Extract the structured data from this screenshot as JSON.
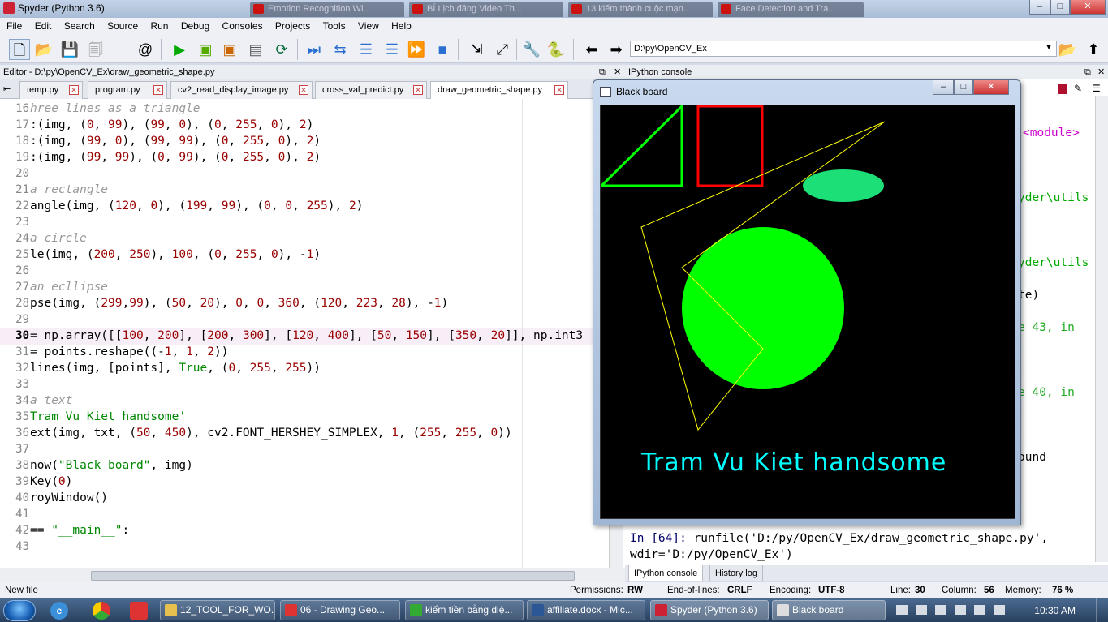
{
  "window": {
    "title": "Spyder (Python 3.6)"
  },
  "background_tabs": [
    "Emotion Recognition Wi...",
    "BÍ Lịch đăng Video Th...",
    "13 kiếm thành cuộc mạn...",
    "Face Detection and Tra..."
  ],
  "menu": [
    "File",
    "Edit",
    "Search",
    "Source",
    "Run",
    "Debug",
    "Consoles",
    "Projects",
    "Tools",
    "View",
    "Help"
  ],
  "toolbar": {
    "path": "D:\\py\\OpenCV_Ex",
    "icons": [
      "new-file-icon",
      "open-folder-icon",
      "save-icon",
      "save-all-icon",
      "at-icon",
      "run-icon",
      "run-cell-icon",
      "run-cell-advance-icon",
      "run-selection-icon",
      "rerun-icon",
      "debug-icon",
      "step-icon",
      "step-into-icon",
      "step-return-icon",
      "continue-icon",
      "stop-icon",
      "maximize-pane-icon",
      "fullscreen-icon",
      "preferences-icon",
      "python-path-icon",
      "back-icon",
      "forward-icon"
    ]
  },
  "editor": {
    "header": "Editor - D:\\py\\OpenCV_Ex\\draw_geometric_shape.py",
    "tabs": [
      "temp.py",
      "program.py",
      "cv2_read_display_image.py",
      "cross_val_predict.py",
      "draw_geometric_shape.py"
    ],
    "lines": [
      {
        "n": "16",
        "t": "hree lines as a triangle"
      },
      {
        "n": "17",
        "t": ":(img, (0, 99), (99, 0), (0, 255, 0), 2)"
      },
      {
        "n": "18",
        "t": ":(img, (99, 0), (99, 99), (0, 255, 0), 2)"
      },
      {
        "n": "19",
        "t": ":(img, (99, 99), (0, 99), (0, 255, 0), 2)"
      },
      {
        "n": "20",
        "t": ""
      },
      {
        "n": "21",
        "t": "a rectangle"
      },
      {
        "n": "22",
        "t": "angle(img, (120, 0), (199, 99), (0, 0, 255), 2)"
      },
      {
        "n": "23",
        "t": ""
      },
      {
        "n": "24",
        "t": "a circle"
      },
      {
        "n": "25",
        "t": "le(img, (200, 250), 100, (0, 255, 0), -1)"
      },
      {
        "n": "26",
        "t": ""
      },
      {
        "n": "27",
        "t": "an ecllipse"
      },
      {
        "n": "28",
        "t": "pse(img, (299,99), (50, 20), 0, 0, 360, (120, 223, 28), -1)"
      },
      {
        "n": "29",
        "t": ""
      },
      {
        "n": "30",
        "t": "= np.array([[100, 200], [200, 300], [120, 400], [50, 150], [350, 20]], np.int3"
      },
      {
        "n": "31",
        "t": "= points.reshape((-1, 1, 2))"
      },
      {
        "n": "32",
        "t": "lines(img, [points], True, (0, 255, 255))"
      },
      {
        "n": "33",
        "t": ""
      },
      {
        "n": "34",
        "t": "a text"
      },
      {
        "n": "35",
        "t": "Tram Vu Kiet handsome'"
      },
      {
        "n": "36",
        "t": "ext(img, txt, (50, 450), cv2.FONT_HERSHEY_SIMPLEX, 1, (255, 255, 0))"
      },
      {
        "n": "37",
        "t": ""
      },
      {
        "n": "38",
        "t": "now(\"Black board\", img)"
      },
      {
        "n": "39",
        "t": "Key(0)"
      },
      {
        "n": "40",
        "t": "royWindow()"
      },
      {
        "n": "41",
        "t": ""
      },
      {
        "n": "42",
        "t": "== \"__main__\":"
      },
      {
        "n": "43",
        "t": ""
      }
    ],
    "current_line": "30"
  },
  "console": {
    "header": "IPython console",
    "fragments": [
      "<module>",
      "yder\\utils",
      "yder\\utils",
      "te)",
      "e 43, in",
      "e 40, in",
      "ound"
    ],
    "prompt": "In [64]:",
    "command": " runfile('D:/py/OpenCV_Ex/draw_geometric_shape.py',",
    "command2": "wdir='D:/py/OpenCV_Ex')",
    "tabs": [
      "IPython console",
      "History log"
    ]
  },
  "blackboard": {
    "title": "Black board",
    "text": "Tram Vu Kiet handsome",
    "colors": {
      "triangle": "#00ff00",
      "rectangle": "#ff0000",
      "circle": "#00ff00",
      "ellipse": "#1cdf78",
      "polyline": "#ffff00",
      "text": "#00ffff"
    }
  },
  "status": {
    "left": "New file",
    "permissions_label": "Permissions:",
    "permissions": "RW",
    "eol_label": "End-of-lines:",
    "eol": "CRLF",
    "encoding_label": "Encoding:",
    "encoding": "UTF-8",
    "line_label": "Line:",
    "line": "30",
    "column_label": "Column:",
    "column": "56",
    "memory_label": "Memory:",
    "memory": "76 %"
  },
  "taskbar": {
    "items": [
      "12_TOOL_FOR_WO...",
      "06 - Drawing Geo...",
      "kiếm tiền bằng điệ...",
      "affiliate.docx - Mic...",
      "Spyder (Python 3.6)",
      "Black board"
    ],
    "clock": "10:30 AM"
  }
}
